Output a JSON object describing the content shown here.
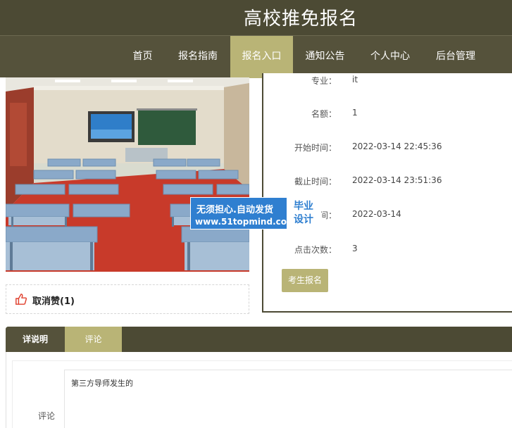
{
  "site": {
    "title": "高校推免报名"
  },
  "nav": {
    "items": [
      {
        "label": "首页"
      },
      {
        "label": "报名指南"
      },
      {
        "label": "报名入口",
        "active": true
      },
      {
        "label": "通知公告"
      },
      {
        "label": "个人中心"
      },
      {
        "label": "后台管理"
      }
    ]
  },
  "detail": {
    "rows": [
      {
        "key": "专业：",
        "value": "it"
      },
      {
        "key": "名额：",
        "value": "1"
      },
      {
        "key": "开始时间：",
        "value": "2022-03-14 22:45:36"
      },
      {
        "key": "截止时间：",
        "value": "2022-03-14 23:51:36"
      },
      {
        "key": "时间：",
        "value": "2022-03-14"
      },
      {
        "key": "点击次数：",
        "value": "3"
      }
    ],
    "signup_button": "考生报名"
  },
  "like": {
    "label": "取消赞(1)",
    "icon": "thumbs-up-icon"
  },
  "watermark": {
    "line1": "无须担心.自动发货",
    "line2": "www.51topmind.com",
    "badge_line1": "毕业",
    "badge_line2": "设计"
  },
  "tabs": [
    {
      "label": "详说明"
    },
    {
      "label": "评论",
      "active": true
    }
  ],
  "comment": {
    "label": "评论",
    "value": "第三方导师发生的"
  },
  "colors": {
    "header_bg": "#4c4a34",
    "nav_bg": "#55523b",
    "accent": "#b9b476",
    "like_icon": "#e0402e",
    "watermark_bg": "#2f7fd0"
  }
}
